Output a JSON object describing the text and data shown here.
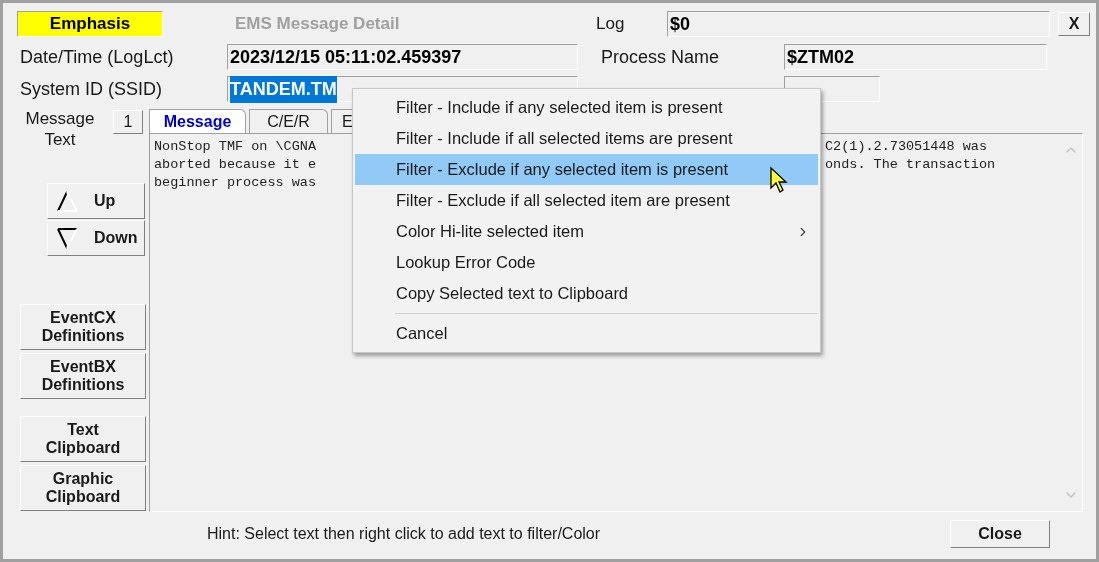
{
  "window": {
    "title": "EMS Message Detail",
    "close_label": "X"
  },
  "emphasis": "Emphasis",
  "log": {
    "label": "Log",
    "value": "$0"
  },
  "left_fields": [
    {
      "label": "Date/Time (LogLct)",
      "value": "2023/12/15 05:11:02.459397",
      "selected": false
    },
    {
      "label": "System ID (SSID)",
      "value": "TANDEM.TM",
      "selected": true
    }
  ],
  "right_fields": [
    {
      "label": "Process Name",
      "value": "$ZTM02"
    }
  ],
  "message_label": "Message Text",
  "message_index": "1",
  "tabs": [
    {
      "label": "Message",
      "selected": true
    },
    {
      "label": "C/E/R",
      "selected": false
    },
    {
      "label": "E",
      "selected": false
    }
  ],
  "message_lines": [
    {
      "left": "NonStop TMF on \\CGNA",
      "right": "C2(1).2.73051448 was"
    },
    {
      "left": "aborted because it e",
      "right": "onds. The transaction"
    },
    {
      "left": "beginner process was"
    }
  ],
  "nav_buttons": [
    {
      "label": "Up",
      "kind": "up"
    },
    {
      "label": "Down",
      "kind": "down"
    }
  ],
  "button_groups": [
    [
      "EventCX Definitions",
      "EventBX Definitions"
    ],
    [
      "Text Clipboard",
      "Graphic Clipboard"
    ]
  ],
  "hint": "Hint: Select text then right click to add text to filter/Color",
  "close_button": "Close",
  "context_menu": [
    {
      "kind": "item",
      "label": "Filter - Include if any selected item is present",
      "selected": false
    },
    {
      "kind": "item",
      "label": "Filter - Include if all selected items are present",
      "selected": false
    },
    {
      "kind": "item",
      "label": "Filter - Exclude if any selected item is present",
      "selected": true
    },
    {
      "kind": "item",
      "label": "Filter - Exclude if all selected item are present",
      "selected": false
    },
    {
      "kind": "submenu",
      "label": "Color Hi-lite selected item",
      "selected": false
    },
    {
      "kind": "item",
      "label": "Lookup Error Code",
      "selected": false
    },
    {
      "kind": "item",
      "label": "Copy Selected text to Clipboard",
      "selected": false
    },
    {
      "kind": "separator"
    },
    {
      "kind": "item",
      "label": "Cancel",
      "selected": false
    }
  ]
}
